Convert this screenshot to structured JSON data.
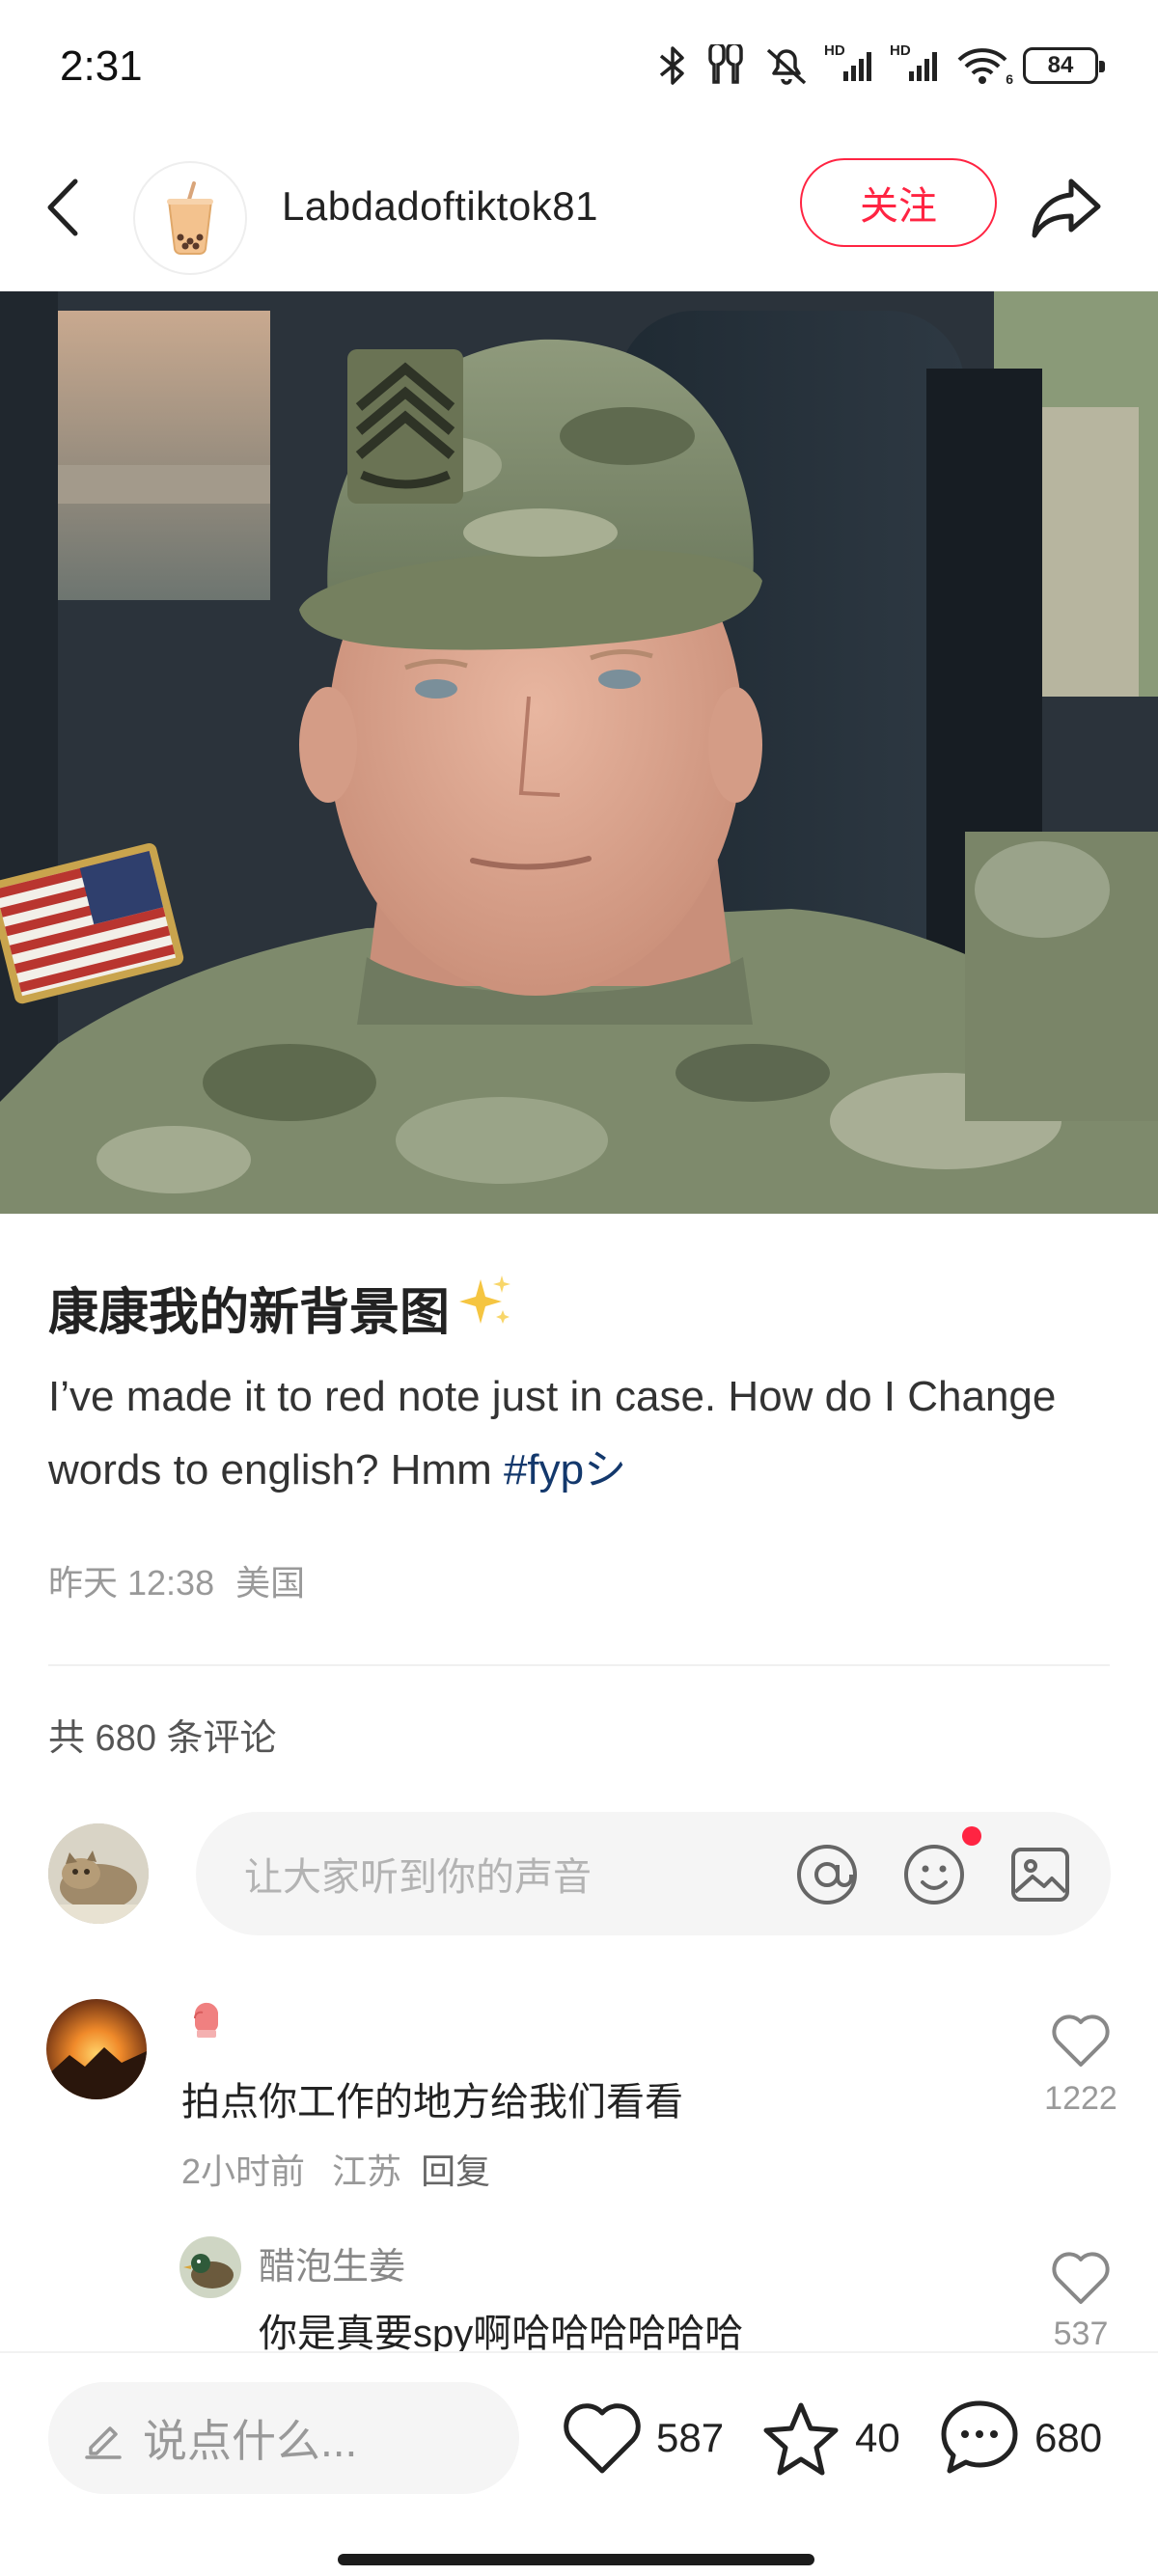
{
  "status_bar": {
    "time": "2:31",
    "battery": "84",
    "icons": [
      "bluetooth-icon",
      "earbuds-icon",
      "mute-icon",
      "signal-hd-icon",
      "signal-hd-icon",
      "wifi-icon",
      "battery-icon"
    ],
    "signal_label": "HD",
    "wifi_label": "6"
  },
  "header": {
    "username": "Labdadoftiktok81",
    "follow_label": "关注",
    "avatar_icon": "bubble-tea-icon"
  },
  "post": {
    "title": "康康我的新背景图",
    "title_emoji": "sparkles-icon",
    "body_prefix": "I’ve made it to red note just in case. How do I Change words to english? Hmm ",
    "hashtag": "#fypシ",
    "date": "昨天 12:38",
    "location": "美国",
    "comment_count_label": "共 680 条评论"
  },
  "comment_input": {
    "placeholder": "让大家听到你的声音",
    "icons": [
      "at-icon",
      "emoji-icon",
      "image-icon"
    ]
  },
  "comments": [
    {
      "text": "拍点你工作的地方给我们看看",
      "time": "2小时前",
      "location": "江苏",
      "reply_label": "回复",
      "likes": "1222",
      "badge_icon": "boxing-glove-icon"
    }
  ],
  "replies": [
    {
      "name": "醋泡生姜",
      "text": "你是真要spy啊哈哈哈哈哈哈",
      "likes": "537"
    }
  ],
  "bottom_bar": {
    "say_placeholder": "说点什么...",
    "likes": "587",
    "stars": "40",
    "comments": "680"
  },
  "colors": {
    "accent": "#ff2442",
    "hashtag": "#13386c",
    "muted_text": "#999999"
  }
}
